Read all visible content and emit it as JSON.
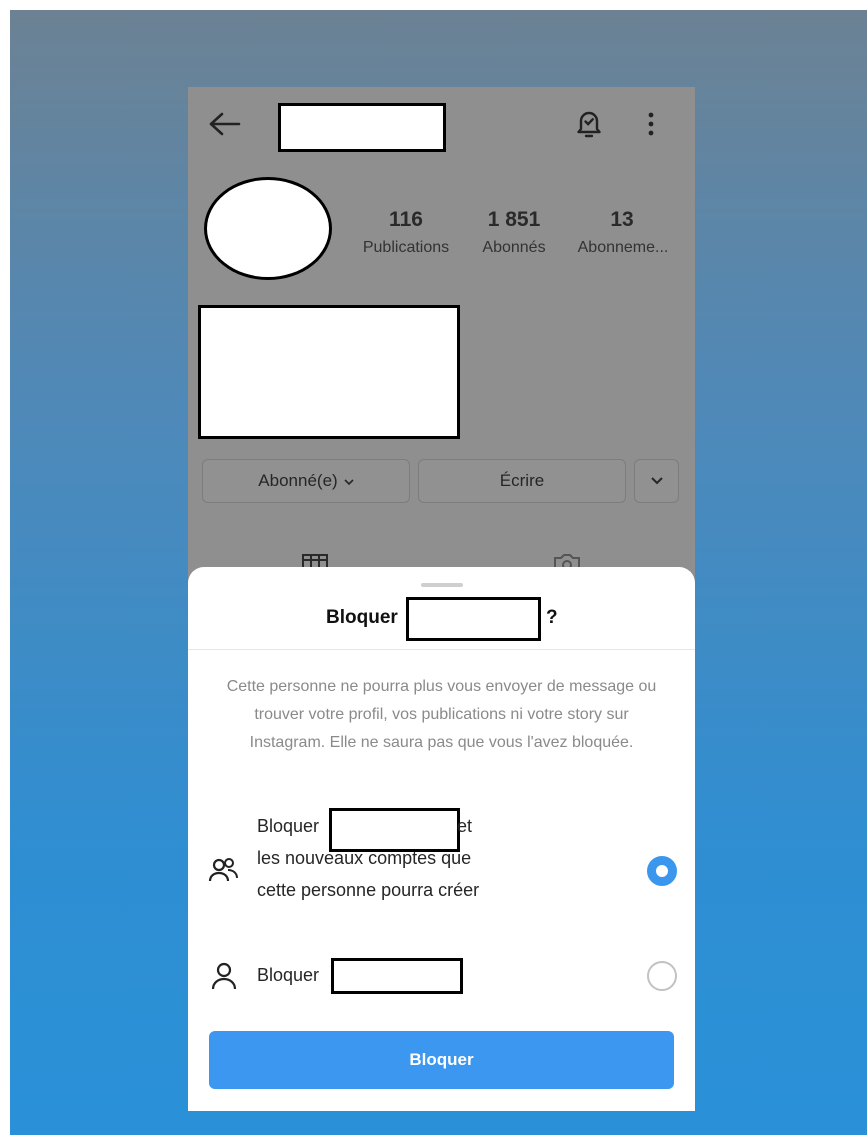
{
  "profile": {
    "stats": [
      {
        "value": "116",
        "label": "Publications"
      },
      {
        "value": "1 851",
        "label": "Abonnés"
      },
      {
        "value": "13",
        "label": "Abonneme..."
      }
    ],
    "follow_button": "Abonné(e)",
    "follow_chevron": "⌄",
    "message_button": "Écrire",
    "more_chevron": "⌄"
  },
  "header": {
    "back_icon": "arrow-left",
    "bell_icon": "bell-check",
    "menu_icon": "more-vertical"
  },
  "sheet": {
    "title_prefix": "Bloquer",
    "title_suffix": "?",
    "description": "Cette personne ne pourra plus vous envoyer de message ou trouver votre profil, vos publications ni votre story sur Instagram. Elle ne saura pas que vous l'avez bloquée.",
    "option1": {
      "prefix": "Bloquer",
      "after": "et",
      "line2": "les nouveaux comptes que",
      "line3": "cette personne pourra créer",
      "selected": true
    },
    "option2": {
      "prefix": "Bloquer",
      "selected": false
    },
    "confirm_button": "Bloquer"
  },
  "colors": {
    "accent": "#3b97f0",
    "dim_overlay": "#8f8f8f"
  }
}
